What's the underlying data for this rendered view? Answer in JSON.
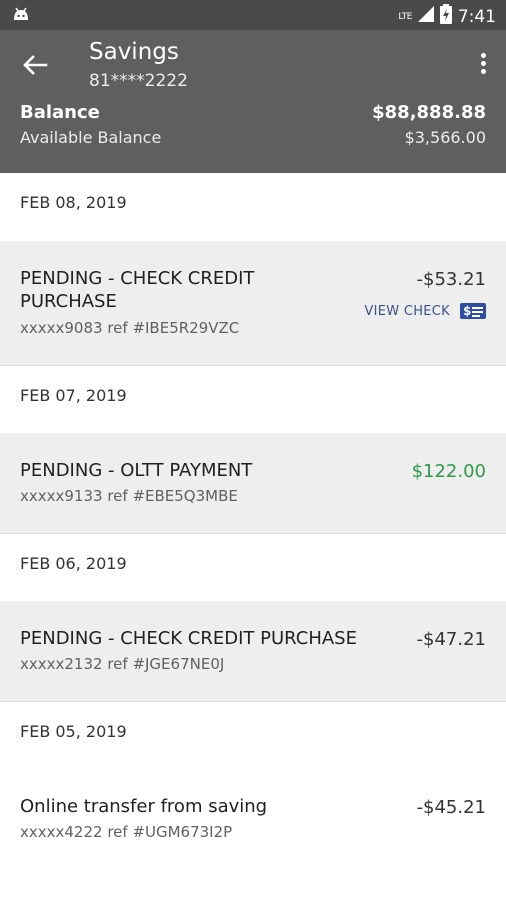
{
  "status_bar": {
    "network": "LTE",
    "time": "7:41"
  },
  "header": {
    "title": "Savings",
    "account_number": "81****2222",
    "balance_label": "Balance",
    "balance_value": "$88,888.88",
    "available_label": "Available Balance",
    "available_value": "$3,566.00"
  },
  "colors": {
    "header_bg": "#5f5f5f",
    "status_bg": "#4a4a4a",
    "credit_green": "#2e9a4a",
    "link_blue": "#3b4f8a"
  },
  "groups": [
    {
      "date": "FEB 08, 2019",
      "transactions": [
        {
          "description": "PENDING - CHECK CREDIT PURCHASE",
          "ref": "xxxxx9083 ref #IBE5R29VZC",
          "amount": "-$53.21",
          "action": "VIEW CHECK"
        }
      ]
    },
    {
      "date": "FEB 07, 2019",
      "transactions": [
        {
          "description": "PENDING - OLTT PAYMENT",
          "ref": "xxxxx9133 ref #EBE5Q3MBE",
          "amount": "$122.00"
        }
      ]
    },
    {
      "date": "FEB 06, 2019",
      "transactions": [
        {
          "description": "PENDING - CHECK CREDIT PURCHASE",
          "ref": "xxxxx2132 ref #JGE67NE0J",
          "amount": "-$47.21"
        }
      ]
    },
    {
      "date": "FEB 05, 2019",
      "transactions": [
        {
          "description": "Online transfer from saving",
          "ref": "xxxxx4222 ref #UGM673I2P",
          "amount": "-$45.21"
        }
      ]
    }
  ]
}
